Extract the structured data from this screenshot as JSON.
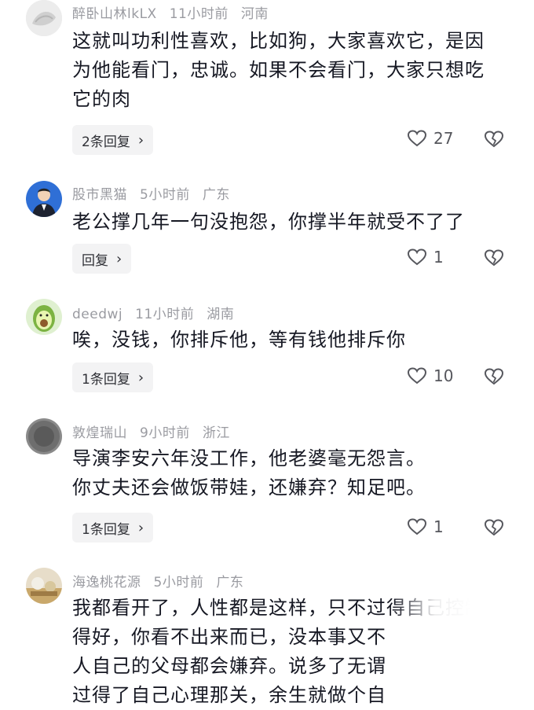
{
  "comments": [
    {
      "username": "醉卧山林lkLX",
      "time": "11小时前",
      "location": "河南",
      "lines": [
        "这就叫功利性喜欢，比如狗，大家喜欢它，是因",
        "为他能看门，忠诚。如果不会看门，大家只想吃",
        "它的肉"
      ],
      "reply_label": "2条回复",
      "likes": "27"
    },
    {
      "username": "股市黑猫",
      "time": "5小时前",
      "location": "广东",
      "lines": [
        "老公撑几年一句没抱怨，你撑半年就受不了了"
      ],
      "reply_label": "回复",
      "likes": "1"
    },
    {
      "username": "deedwj",
      "time": "11小时前",
      "location": "湖南",
      "lines": [
        "唉，没钱，你排斥他，等有钱他排斥你"
      ],
      "reply_label": "1条回复",
      "likes": "10"
    },
    {
      "username": "敦煌瑞山",
      "time": "9小时前",
      "location": "浙江",
      "lines": [
        "导演李安六年没工作，他老婆毫无怨言。",
        "你丈夫还会做饭带娃，还嫌弃？知足吧。"
      ],
      "reply_label": "1条回复",
      "likes": "1"
    },
    {
      "username": "海逸桃花源",
      "time": "5小时前",
      "location": "广东",
      "lines": [
        "我都看开了，人性都是这样，只不过得自己控制",
        "得好，你看不出来而已，没本事又不",
        "人自己的父母都会嫌弃。说多了无谓",
        "过得了自己心理那关，余生就做个自"
      ]
    }
  ],
  "icons": {
    "like": "heart-outline-icon",
    "dislike": "broken-heart-icon",
    "chevron": "chevron-right-icon"
  }
}
